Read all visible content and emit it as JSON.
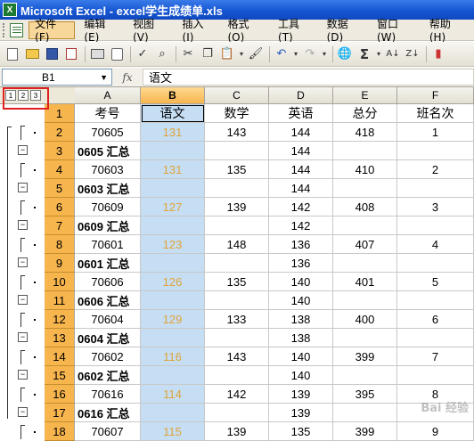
{
  "window": {
    "title": "Microsoft Excel - excel学生成绩单.xls",
    "app_icon_letter": "X"
  },
  "menu": [
    "文件(F)",
    "编辑(E)",
    "视图(V)",
    "插入(I)",
    "格式(O)",
    "工具(T)",
    "数据(D)",
    "窗口(W)",
    "帮助(H)"
  ],
  "formula_bar": {
    "name_box": "B1",
    "fx": "fx",
    "content": "语文"
  },
  "outline_levels": [
    "1",
    "2",
    "3"
  ],
  "columns": [
    "A",
    "B",
    "C",
    "D",
    "E",
    "F"
  ],
  "rows": [
    {
      "n": "1",
      "A": "考号",
      "B": "语文",
      "C": "数学",
      "D": "英语",
      "E": "总分",
      "F": "班名次",
      "type": "header"
    },
    {
      "n": "2",
      "A": "70605",
      "B": "131",
      "C": "143",
      "D": "144",
      "E": "418",
      "F": "1",
      "type": "data"
    },
    {
      "n": "3",
      "A": "0605 汇总",
      "B": "",
      "C": "",
      "D": "144",
      "E": "",
      "F": "",
      "type": "summary"
    },
    {
      "n": "4",
      "A": "70603",
      "B": "131",
      "C": "135",
      "D": "144",
      "E": "410",
      "F": "2",
      "type": "data"
    },
    {
      "n": "5",
      "A": "0603 汇总",
      "B": "",
      "C": "",
      "D": "144",
      "E": "",
      "F": "",
      "type": "summary"
    },
    {
      "n": "6",
      "A": "70609",
      "B": "127",
      "C": "139",
      "D": "142",
      "E": "408",
      "F": "3",
      "type": "data"
    },
    {
      "n": "7",
      "A": "0609 汇总",
      "B": "",
      "C": "",
      "D": "142",
      "E": "",
      "F": "",
      "type": "summary"
    },
    {
      "n": "8",
      "A": "70601",
      "B": "123",
      "C": "148",
      "D": "136",
      "E": "407",
      "F": "4",
      "type": "data"
    },
    {
      "n": "9",
      "A": "0601 汇总",
      "B": "",
      "C": "",
      "D": "136",
      "E": "",
      "F": "",
      "type": "summary"
    },
    {
      "n": "10",
      "A": "70606",
      "B": "126",
      "C": "135",
      "D": "140",
      "E": "401",
      "F": "5",
      "type": "data"
    },
    {
      "n": "11",
      "A": "0606 汇总",
      "B": "",
      "C": "",
      "D": "140",
      "E": "",
      "F": "",
      "type": "summary"
    },
    {
      "n": "12",
      "A": "70604",
      "B": "129",
      "C": "133",
      "D": "138",
      "E": "400",
      "F": "6",
      "type": "data"
    },
    {
      "n": "13",
      "A": "0604 汇总",
      "B": "",
      "C": "",
      "D": "138",
      "E": "",
      "F": "",
      "type": "summary"
    },
    {
      "n": "14",
      "A": "70602",
      "B": "116",
      "C": "143",
      "D": "140",
      "E": "399",
      "F": "7",
      "type": "data"
    },
    {
      "n": "15",
      "A": "0602 汇总",
      "B": "",
      "C": "",
      "D": "140",
      "E": "",
      "F": "",
      "type": "summary"
    },
    {
      "n": "16",
      "A": "70616",
      "B": "114",
      "C": "142",
      "D": "139",
      "E": "395",
      "F": "8",
      "type": "data"
    },
    {
      "n": "17",
      "A": "0616 汇总",
      "B": "",
      "C": "",
      "D": "139",
      "E": "",
      "F": "",
      "type": "summary"
    },
    {
      "n": "18",
      "A": "70607",
      "B": "115",
      "C": "139",
      "D": "135",
      "E": "399",
      "F": "9",
      "type": "data"
    }
  ],
  "selected_column": "B",
  "score_color": "#e0a338",
  "watermark": "Bai 经验"
}
